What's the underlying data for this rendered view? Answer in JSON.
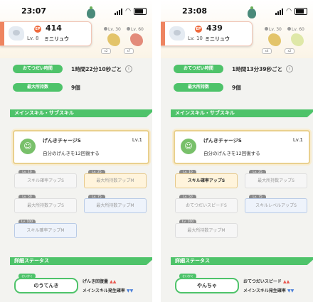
{
  "left": {
    "status_time": "23:07",
    "energy": "414",
    "energy_icon": "EP",
    "level": "Lv. 8",
    "pokemon_name": "ミニリュウ",
    "evolutions": [
      {
        "lv": "Lv. 30",
        "badge": "x2",
        "color": "#e3c46a"
      },
      {
        "lv": "Lv. 60",
        "badge": "x7",
        "color": "#e38b7a"
      }
    ],
    "help_label": "おてつだい時間",
    "help_value": "1時間22分10秒ごと",
    "info_icon": "i",
    "carry_label": "最大所持数",
    "carry_value": "9個",
    "section_skill": "メインスキル・サブスキル",
    "main_skill_icon": "☺",
    "main_skill_name": "げんきチャージS",
    "main_skill_lv": "Lv.1",
    "main_skill_desc": "自分のげんきを12回復する",
    "sub_skills": [
      {
        "lv": "Lv. 10",
        "label": "スキル確率アップS"
      },
      {
        "lv": "Lv. 25",
        "label": "最大所持数アップM"
      },
      {
        "lv": "Lv. 50",
        "label": "最大所持数アップS"
      },
      {
        "lv": "Lv. 75",
        "label": "最大所持数アップM"
      },
      {
        "lv": "Lv. 100",
        "label": "スキル確率アップM"
      }
    ],
    "section_status": "詳細ステータス",
    "nature_lv": "せいかく",
    "nature": "のうてんき",
    "nature_up": "げんき回復量",
    "nature_down": "メインスキル発生確率",
    "up_marks": "▲▲",
    "down_marks": "▼▼"
  },
  "right": {
    "status_time": "23:08",
    "energy": "439",
    "energy_icon": "EP",
    "level": "Lv. 10",
    "pokemon_name": "ミニリュウ",
    "evolutions": [
      {
        "lv": "Lv. 30",
        "badge": "x4",
        "color": "#e3c46a"
      },
      {
        "lv": "Lv. 60",
        "badge": "x2",
        "color": "#dfe8a8"
      }
    ],
    "help_label": "おてつだい時間",
    "help_value": "1時間13分39秒ごと",
    "info_icon": "i",
    "carry_label": "最大所持数",
    "carry_value": "9個",
    "section_skill": "メインスキル・サブスキル",
    "main_skill_icon": "☺",
    "main_skill_name": "げんきチャージS",
    "main_skill_lv": "Lv.1",
    "main_skill_desc": "自分のげんきを12回復する",
    "sub_skills": [
      {
        "lv": "Lv. 10",
        "label": "スキル確率アップS"
      },
      {
        "lv": "Lv. 25",
        "label": "最大所持数アップS"
      },
      {
        "lv": "Lv. 50",
        "label": "おてつだいスピードS"
      },
      {
        "lv": "Lv. 75",
        "label": "スキルレベルアップS"
      },
      {
        "lv": "Lv. 100",
        "label": "最大所持数アップM"
      }
    ],
    "section_status": "詳細ステータス",
    "nature_lv": "せいかく",
    "nature": "やんちゃ",
    "nature_up": "おてつだいスピード",
    "nature_down": "メインスキル発生確率",
    "up_marks": "▲▲",
    "down_marks": "▼▼"
  }
}
